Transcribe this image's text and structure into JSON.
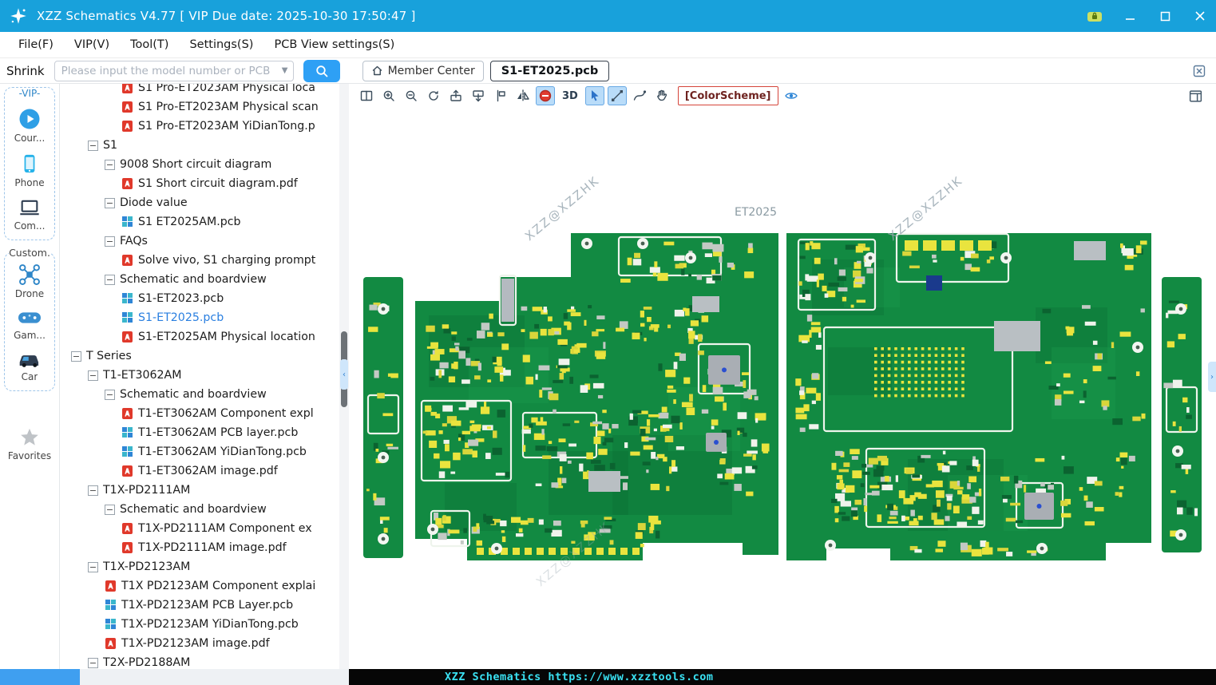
{
  "titlebar": {
    "title": "XZZ Schematics V4.77 [ VIP Due date: 2025-10-30 17:50:47 ]"
  },
  "menubar": {
    "items": [
      "File(F)",
      "VIP(V)",
      "Tool(T)",
      "Settings(S)",
      "PCB View settings(S)"
    ]
  },
  "toolbar": {
    "shrink_label": "Shrink",
    "search_placeholder": "Please input the model number or PCB",
    "member_center_label": "Member Center",
    "active_tab": "S1-ET2025.pcb"
  },
  "vip_sidebar": {
    "vip_group_label": "-VIP-",
    "vip_items": [
      {
        "icon": "play-circle-icon",
        "label": "Cour..."
      },
      {
        "icon": "smartphone-icon",
        "label": "Phone"
      },
      {
        "icon": "computer-icon",
        "label": "Com..."
      }
    ],
    "custom_group_label": "Custom.",
    "custom_items": [
      {
        "icon": "drone-icon",
        "label": "Drone"
      },
      {
        "icon": "gamepad-icon",
        "label": "Gam..."
      },
      {
        "icon": "car-icon",
        "label": "Car"
      }
    ],
    "favorites_label": "Favorites"
  },
  "tree": {
    "items": [
      {
        "kind": "pdf",
        "label": "S1 Pro-ET2023AM Physical loca",
        "level": 3
      },
      {
        "kind": "pdf",
        "label": "S1 Pro-ET2023AM Physical scan",
        "level": 3
      },
      {
        "kind": "pdf",
        "label": "S1 Pro-ET2023AM YiDianTong.p",
        "level": 3
      },
      {
        "kind": "branch",
        "label": "S1",
        "level": 1
      },
      {
        "kind": "branch",
        "label": "9008 Short circuit diagram",
        "level": 2
      },
      {
        "kind": "pdf",
        "label": "S1 Short circuit diagram.pdf",
        "level": 3
      },
      {
        "kind": "branch",
        "label": "Diode value",
        "level": 2
      },
      {
        "kind": "pcb",
        "label": "S1 ET2025AM.pcb",
        "level": 3
      },
      {
        "kind": "branch",
        "label": "FAQs",
        "level": 2
      },
      {
        "kind": "pdf",
        "label": "Solve vivo, S1 charging prompt",
        "level": 3
      },
      {
        "kind": "branch",
        "label": "Schematic and boardview",
        "level": 2
      },
      {
        "kind": "pcb",
        "label": "S1-ET2023.pcb",
        "level": 3
      },
      {
        "kind": "pcb",
        "label": "S1-ET2025.pcb",
        "level": 3,
        "selected": true
      },
      {
        "kind": "pdf",
        "label": "S1-ET2025AM Physical location",
        "level": 3
      },
      {
        "kind": "branch",
        "label": "T Series",
        "level": 0
      },
      {
        "kind": "branch",
        "label": "T1-ET3062AM",
        "level": 1
      },
      {
        "kind": "branch",
        "label": "Schematic and boardview",
        "level": 2
      },
      {
        "kind": "pdf",
        "label": "T1-ET3062AM Component expl",
        "level": 3
      },
      {
        "kind": "pcb",
        "label": "T1-ET3062AM PCB layer.pcb",
        "level": 3
      },
      {
        "kind": "pcb",
        "label": "T1-ET3062AM YiDianTong.pcb",
        "level": 3
      },
      {
        "kind": "pdf",
        "label": "T1-ET3062AM image.pdf",
        "level": 3
      },
      {
        "kind": "branch",
        "label": "T1X-PD2111AM",
        "level": 1
      },
      {
        "kind": "branch",
        "label": "Schematic and boardview",
        "level": 2
      },
      {
        "kind": "pdf",
        "label": "T1X-PD2111AM Component ex",
        "level": 3
      },
      {
        "kind": "pdf",
        "label": "T1X-PD2111AM image.pdf",
        "level": 3
      },
      {
        "kind": "branch",
        "label": "T1X-PD2123AM",
        "level": 1
      },
      {
        "kind": "pdf",
        "label": "T1X PD2123AM Component explai",
        "level": 2
      },
      {
        "kind": "pcb",
        "label": "T1X-PD2123AM PCB Layer.pcb",
        "level": 2
      },
      {
        "kind": "pcb",
        "label": "T1X-PD2123AM YiDianTong.pcb",
        "level": 2
      },
      {
        "kind": "pdf",
        "label": "T1X-PD2123AM image.pdf",
        "level": 2
      },
      {
        "kind": "branch",
        "label": "T2X-PD2188AM",
        "level": 1
      }
    ]
  },
  "viewer": {
    "tools": [
      {
        "id": "split-view"
      },
      {
        "id": "zoom-in"
      },
      {
        "id": "zoom-out"
      },
      {
        "id": "rotate-view"
      },
      {
        "id": "export-top-layer"
      },
      {
        "id": "export-bottom-layer"
      },
      {
        "id": "flip-vertical"
      },
      {
        "id": "mirror-horizontal"
      },
      {
        "id": "diode-mode",
        "active": true
      },
      {
        "id": "threed",
        "kind": "text",
        "label": "3D"
      },
      {
        "id": "select-cursor",
        "active": true
      },
      {
        "id": "measure",
        "active": true
      },
      {
        "id": "curve-tool"
      },
      {
        "id": "pan-hand"
      },
      {
        "id": "colorscheme",
        "kind": "text-outline",
        "label": "[ColorScheme]"
      },
      {
        "id": "layer-eye"
      }
    ],
    "watermark": "XZZ@XZZHK",
    "board_title": "ET2025"
  },
  "statusbar": {
    "text": "XZZ Schematics https://www.xzztools.com"
  },
  "colors": {
    "titlebar": "#18a1db",
    "accent_blue": "#2ea0f5",
    "selected_item": "#2a7fe0",
    "pdf_red": "#e0392b",
    "pcb_green": "#128a42",
    "pad_yellow": "#e9e43e",
    "status_text": "#3ae1f2",
    "colorscheme_border": "#d5443a"
  }
}
